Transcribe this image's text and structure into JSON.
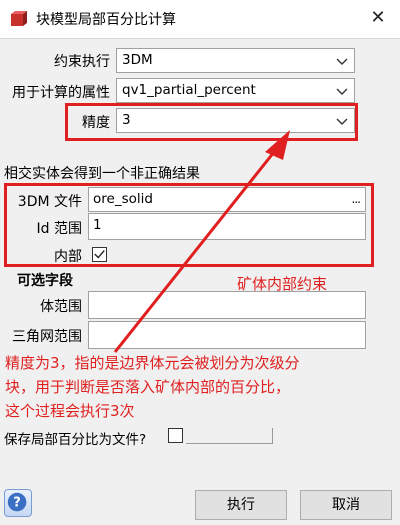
{
  "window": {
    "title": "块模型局部百分比计算",
    "close_glyph": "✕"
  },
  "form": {
    "constraint_label": "约束执行",
    "constraint_value": "3DM",
    "attr_label": "用于计算的属性",
    "attr_value": "qv1_partial_percent",
    "precision_label": "精度",
    "precision_value": "3",
    "intersect_note": "相交实体会得到一个非正确结果",
    "file_label": "3DM 文件",
    "file_value": "ore_solid",
    "file_browse": "...",
    "id_label": "Id 范围",
    "id_value": "1",
    "inside_label": "内部",
    "inside_checked": true,
    "optional_title": "可选字段",
    "volume_label": "体范围",
    "volume_value": "",
    "tri_label": "三角网范围",
    "tri_value": "",
    "save_label": "保存局部百分比为文件?",
    "save_checked": false
  },
  "annotations": {
    "ore_label": "矿体内部约束",
    "line1": "精度为3，指的是边界体元会被划分为次级分",
    "line2": "块，用于判断是否落入矿体内部的百分比，",
    "line3": "这个过程会执行3次"
  },
  "footer": {
    "help_glyph": "?",
    "run_label": "执行",
    "cancel_label": "取消"
  },
  "colors": {
    "annotation": "#e02020",
    "panel": "#f0f0f0",
    "help": "#3a6fc4"
  }
}
